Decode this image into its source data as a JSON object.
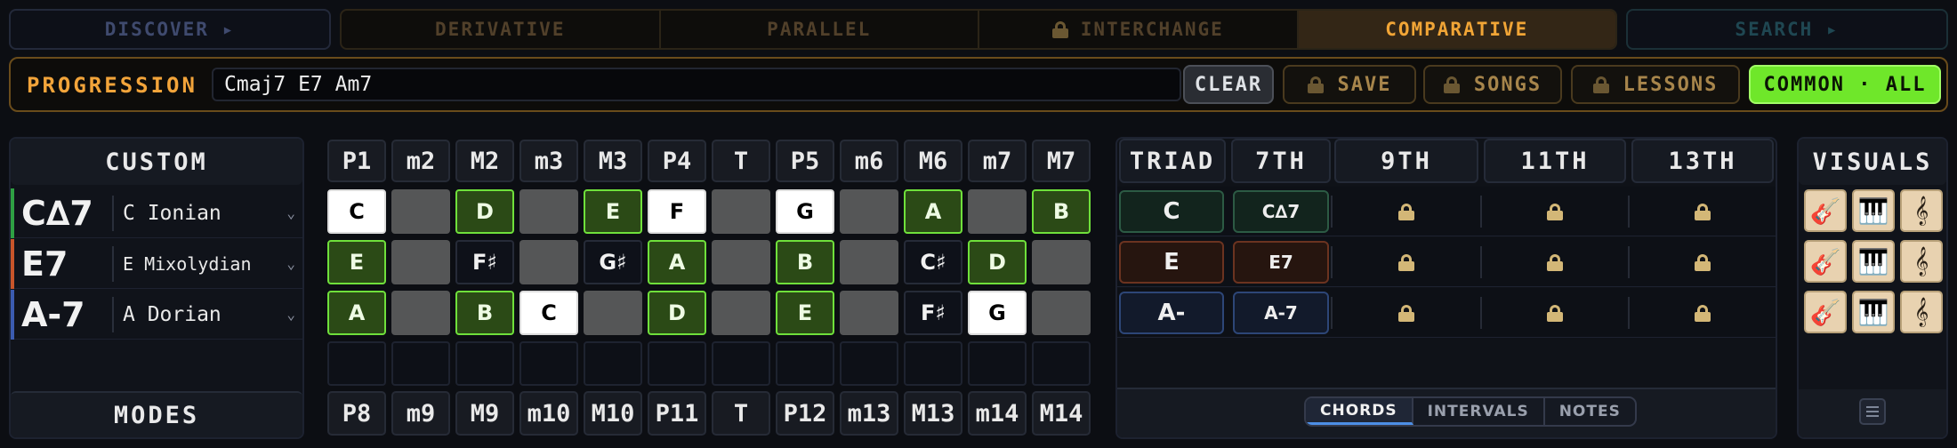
{
  "nav": {
    "discover": "DISCOVER ▸",
    "tabs": [
      {
        "label": "DERIVATIVE",
        "locked": false,
        "active": false
      },
      {
        "label": "PARALLEL",
        "locked": false,
        "active": false
      },
      {
        "label": "INTERCHANGE",
        "locked": true,
        "active": false
      },
      {
        "label": "COMPARATIVE",
        "locked": false,
        "active": true
      }
    ],
    "search": "SEARCH ▸"
  },
  "progression": {
    "label": "PROGRESSION",
    "value": "Cmaj7 E7 Am7",
    "clear": "CLEAR",
    "save": "SAVE",
    "songs": "SONGS",
    "lessons": "LESSONS",
    "common": "COMMON · ALL"
  },
  "left": {
    "header": "CUSTOM",
    "footer": "MODES",
    "rows": [
      {
        "chord": "C∆7",
        "mode": "C Ionian",
        "accent": "#2ea043"
      },
      {
        "chord": "E7",
        "mode": "E Mixolydian",
        "accent": "#c8552a"
      },
      {
        "chord": "A-7",
        "mode": "A Dorian",
        "accent": "#3b5bb0"
      }
    ]
  },
  "intervals": {
    "top": [
      "P1",
      "m2",
      "M2",
      "m3",
      "M3",
      "P4",
      "T",
      "P5",
      "m6",
      "M6",
      "m7",
      "M7"
    ],
    "bottom": [
      "P8",
      "m9",
      "M9",
      "m10",
      "M10",
      "P11",
      "T",
      "P12",
      "m13",
      "M13",
      "m14",
      "M14"
    ]
  },
  "grid": [
    [
      {
        "t": "C",
        "k": "r"
      },
      {
        "t": "",
        "k": "g"
      },
      {
        "t": "D",
        "k": "s"
      },
      {
        "t": "",
        "k": "g"
      },
      {
        "t": "E",
        "k": "s"
      },
      {
        "t": "F",
        "k": "r"
      },
      {
        "t": "",
        "k": "g"
      },
      {
        "t": "G",
        "k": "r"
      },
      {
        "t": "",
        "k": "g"
      },
      {
        "t": "A",
        "k": "s"
      },
      {
        "t": "",
        "k": "g"
      },
      {
        "t": "B",
        "k": "s"
      }
    ],
    [
      {
        "t": "E",
        "k": "s"
      },
      {
        "t": "",
        "k": "g"
      },
      {
        "t": "F♯",
        "k": "o"
      },
      {
        "t": "",
        "k": "g"
      },
      {
        "t": "G♯",
        "k": "o"
      },
      {
        "t": "A",
        "k": "s"
      },
      {
        "t": "",
        "k": "g"
      },
      {
        "t": "B",
        "k": "s"
      },
      {
        "t": "",
        "k": "g"
      },
      {
        "t": "C♯",
        "k": "o"
      },
      {
        "t": "D",
        "k": "s"
      },
      {
        "t": "",
        "k": "g"
      }
    ],
    [
      {
        "t": "A",
        "k": "s"
      },
      {
        "t": "",
        "k": "g"
      },
      {
        "t": "B",
        "k": "s"
      },
      {
        "t": "C",
        "k": "r"
      },
      {
        "t": "",
        "k": "g"
      },
      {
        "t": "D",
        "k": "s"
      },
      {
        "t": "",
        "k": "g"
      },
      {
        "t": "E",
        "k": "s"
      },
      {
        "t": "",
        "k": "g"
      },
      {
        "t": "F♯",
        "k": "o"
      },
      {
        "t": "G",
        "k": "r"
      },
      {
        "t": "",
        "k": "g"
      }
    ],
    [
      {
        "t": "",
        "k": "e"
      },
      {
        "t": "",
        "k": "e"
      },
      {
        "t": "",
        "k": "e"
      },
      {
        "t": "",
        "k": "e"
      },
      {
        "t": "",
        "k": "e"
      },
      {
        "t": "",
        "k": "e"
      },
      {
        "t": "",
        "k": "e"
      },
      {
        "t": "",
        "k": "e"
      },
      {
        "t": "",
        "k": "e"
      },
      {
        "t": "",
        "k": "e"
      },
      {
        "t": "",
        "k": "e"
      },
      {
        "t": "",
        "k": "e"
      }
    ]
  ],
  "chords": {
    "headers": [
      "TRIAD",
      "7TH",
      "9TH",
      "11TH",
      "13TH"
    ],
    "rows": [
      {
        "triad": "C",
        "seventh": "C∆7",
        "bg": "#12241d",
        "border": "#2c5a44"
      },
      {
        "triad": "E",
        "seventh": "E7",
        "bg": "#26150f",
        "border": "#6b3320"
      },
      {
        "triad": "A-",
        "seventh": "A-7",
        "bg": "#121a2b",
        "border": "#2d4677"
      }
    ],
    "view_tabs": [
      "CHORDS",
      "INTERVALS",
      "NOTES"
    ],
    "active_view": "CHORDS"
  },
  "visuals": {
    "header": "VISUALS",
    "icons": [
      "guitar-icon",
      "piano-icon",
      "treble-clef-icon"
    ],
    "glyphs": [
      "🎸",
      "🎹",
      "𝄞"
    ]
  }
}
